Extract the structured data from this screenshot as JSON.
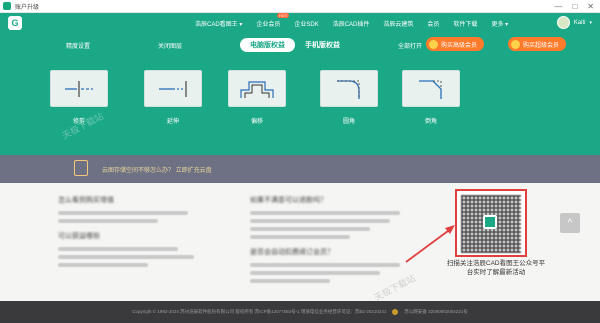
{
  "window": {
    "title": "账户升级",
    "controls": [
      "—",
      "□",
      "✕"
    ]
  },
  "nav": {
    "brand_letter": "G",
    "items": [
      {
        "label": "浩辰CAD看图王 ▾"
      },
      {
        "label": "企业会员",
        "badge": "HOT"
      },
      {
        "label": "企业SDK"
      },
      {
        "label": "浩辰CAD插件"
      },
      {
        "label": "浩辰云建筑"
      },
      {
        "label": "会员"
      },
      {
        "label": "软件下载"
      },
      {
        "label": "更多 ▾"
      }
    ],
    "user": {
      "name": "Kaiti",
      "caret": "▾"
    }
  },
  "banner": {
    "top_labels": [
      "精度设置",
      "关闭图层",
      "全部打开"
    ],
    "tabs": [
      {
        "label": "电脑版权益",
        "active": true
      },
      {
        "label": "手机版权益",
        "active": false
      }
    ],
    "buy_buttons": [
      "购买高级会员",
      "购买超级会员"
    ],
    "features": [
      {
        "label": "修剪"
      },
      {
        "label": "延伸"
      },
      {
        "label": "偏移"
      },
      {
        "label": "圆角"
      },
      {
        "label": "倒角"
      }
    ],
    "watermark": "天极下载站"
  },
  "cloudbar": {
    "text": "云图存储空间不够怎么办？ 立即扩充云盘"
  },
  "footer": {
    "col1": {
      "heading": "怎么看到购买增值",
      "heading2": "可以获益哪些"
    },
    "col2": {
      "heading": "如果不满意可以退款吗？",
      "heading2": "是否会自动扣费续订会员？"
    },
    "qr_caption": "扫描关注浩辰CAD看图王公众号平台实时了解最新活动",
    "watermark": "天极下载站"
  },
  "scroll_top_label": "^",
  "bottombar": {
    "copyright": "Copyright © 1992-2024 苏州浩辰软件股份有限公司 版权所有 苏ICP备12077684号-1 增值电信业务经营许可证：苏B2-20210241",
    "police": "苏公网安备 32050802004221号"
  },
  "colors": {
    "brand": "#1aa886",
    "orange": "#ff7a2a",
    "cloudbar": "#6e7184",
    "footer_dark": "#3a3a3c",
    "highlight_red": "#e04040"
  }
}
